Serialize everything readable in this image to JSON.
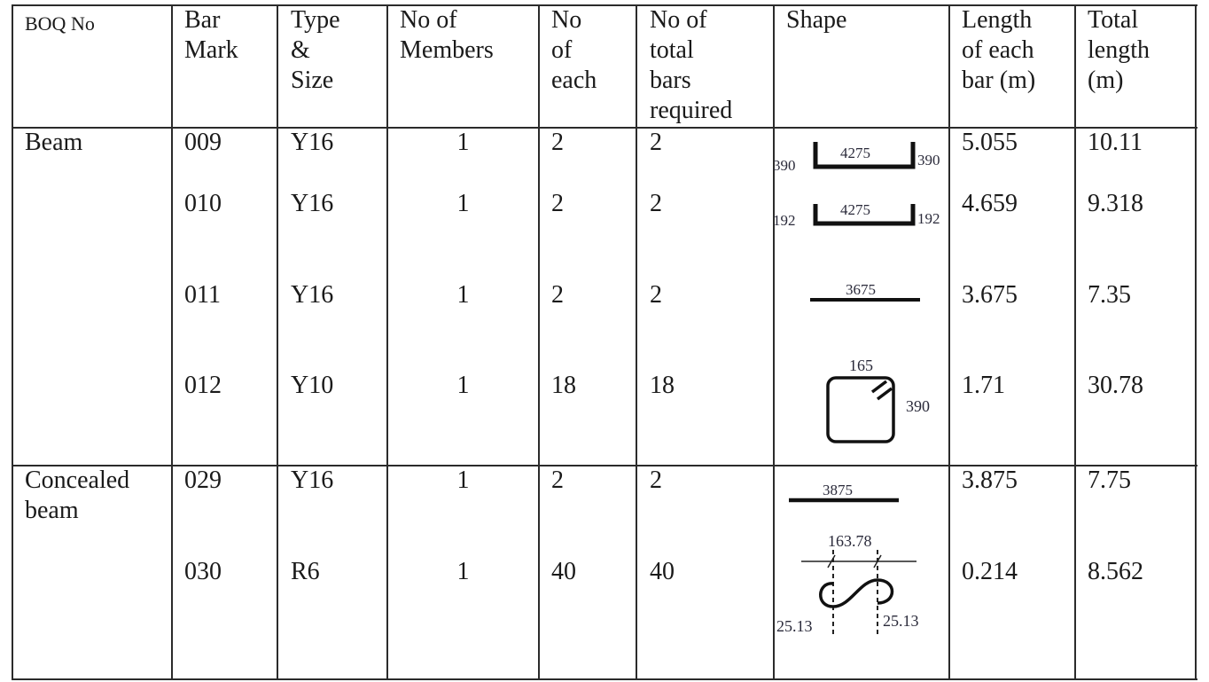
{
  "table": {
    "headers": [
      "BOQ No",
      "Bar\nMark",
      "Type\n&\nSize",
      "No of\nMembers",
      "No\nof\neach",
      "No of\ntotal\nbars\nrequired",
      "Shape",
      "Length\nof each\nbar (m)",
      "Total\nlength\n(m)"
    ],
    "groups": [
      {
        "boq": "Beam",
        "rows": [
          {
            "bar_mark": "009",
            "type_size": "Y16",
            "members": "1",
            "each": "2",
            "total_bars": "2",
            "shape": {
              "kind": "u-bar",
              "labels": {
                "left": "390",
                "middle": "4275",
                "right": "390"
              }
            },
            "length_each": "5.055",
            "total_length": "10.11"
          },
          {
            "bar_mark": "010",
            "type_size": "Y16",
            "members": "1",
            "each": "2",
            "total_bars": "2",
            "shape": {
              "kind": "u-bar",
              "labels": {
                "left": "192",
                "middle": "4275",
                "right": "192"
              }
            },
            "length_each": "4.659",
            "total_length": "9.318"
          },
          {
            "bar_mark": "011",
            "type_size": "Y16",
            "members": "1",
            "each": "2",
            "total_bars": "2",
            "shape": {
              "kind": "straight",
              "labels": {
                "middle": "3675"
              }
            },
            "length_each": "3.675",
            "total_length": "7.35"
          },
          {
            "bar_mark": "012",
            "type_size": "Y10",
            "members": "1",
            "each": "18",
            "total_bars": "18",
            "shape": {
              "kind": "stirrup",
              "labels": {
                "top": "165",
                "right": "390"
              }
            },
            "length_each": "1.71",
            "total_length": "30.78"
          }
        ]
      },
      {
        "boq": "Concealed\nbeam",
        "rows": [
          {
            "bar_mark": "029",
            "type_size": "Y16",
            "members": "1",
            "each": "2",
            "total_bars": "2",
            "shape": {
              "kind": "straight",
              "labels": {
                "middle": "3875"
              }
            },
            "length_each": "3.875",
            "total_length": "7.75"
          },
          {
            "bar_mark": "030",
            "type_size": "R6",
            "members": "1",
            "each": "40",
            "total_bars": "40",
            "shape": {
              "kind": "s-link",
              "labels": {
                "top": "163.78",
                "left": "25.13",
                "right": "25.13"
              }
            },
            "length_each": "0.214",
            "total_length": "8.562"
          }
        ]
      }
    ]
  }
}
